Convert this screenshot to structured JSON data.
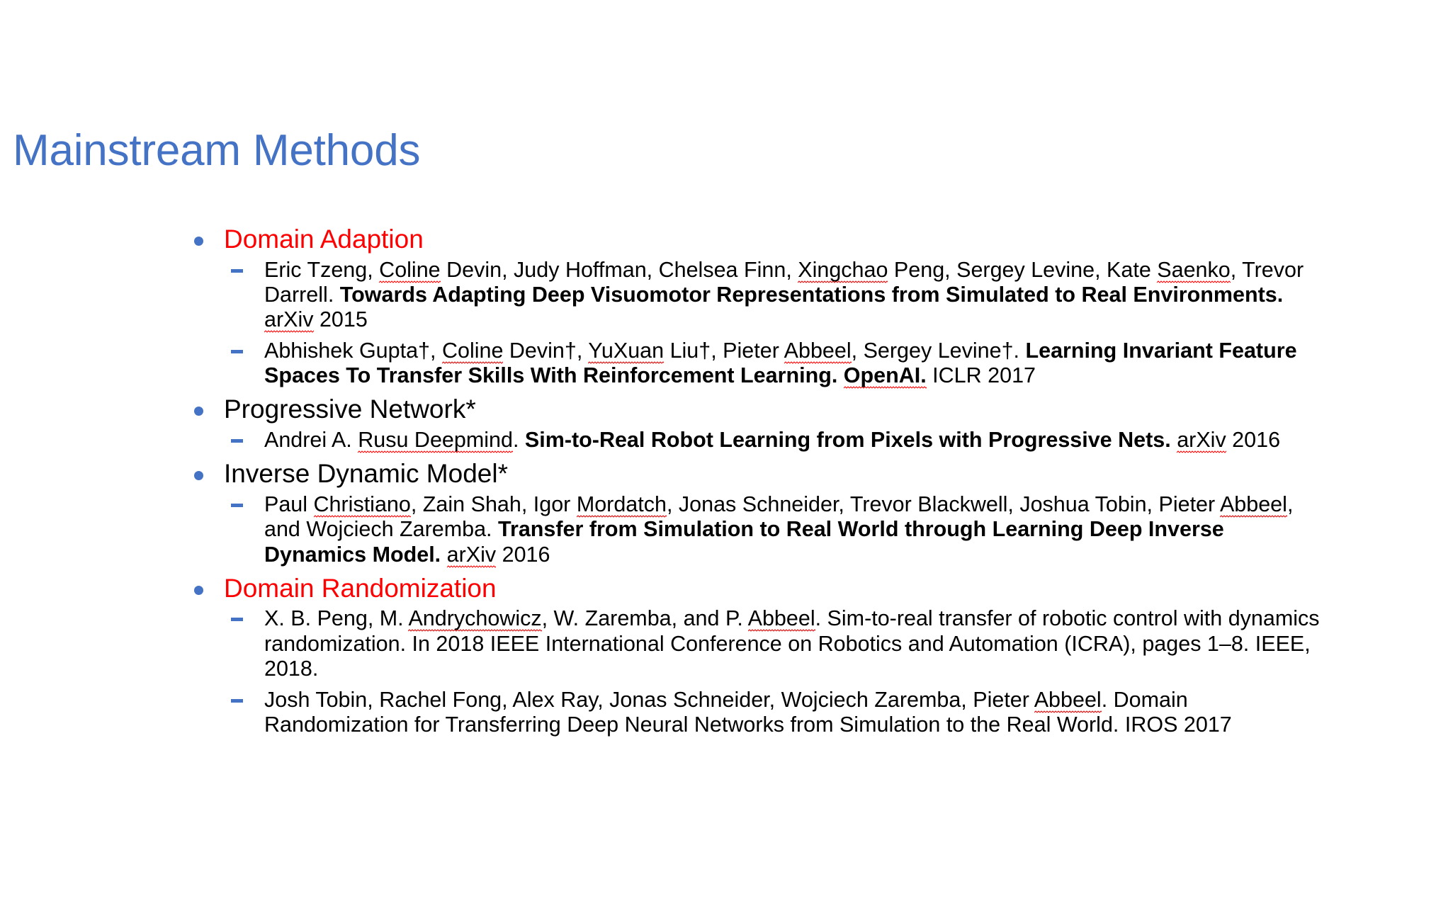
{
  "slide": {
    "title": "Mainstream Methods",
    "title_color": "#4472C4",
    "accent_red": "#FF0000",
    "bullet_color": "#4472C4",
    "background": "#FFFFFF"
  },
  "sections": [
    {
      "heading": "Domain Adaption",
      "heading_color": "#FF0000",
      "citations": [
        {
          "authors": "Eric Tzeng, Coline Devin, Judy Hoffman, Chelsea Finn, Xingchao Peng, Sergey Levine, Kate Saenko, Trevor Darrell.",
          "title": "Towards Adapting Deep Visuomotor Representations from Simulated to Real Environments.",
          "venue": "arXiv 2015",
          "misspelled": [
            "Coline",
            "Xingchao",
            "Saenko",
            "arXiv"
          ]
        },
        {
          "authors": "Abhishek Gupta†, Coline Devin†, YuXuan Liu†, Pieter Abbeel, Sergey Levine†.",
          "title": "Learning Invariant Feature Spaces To Transfer Skills With Reinforcement Learning. OpenAI.",
          "venue": "ICLR 2017",
          "misspelled": [
            "Coline",
            "YuXuan",
            "Abbeel",
            "OpenAI"
          ]
        }
      ]
    },
    {
      "heading": "Progressive Network*",
      "heading_color": "#000000",
      "citations": [
        {
          "authors": "Andrei A. Rusu Deepmind.",
          "title": "Sim-to-Real Robot Learning from Pixels with Progressive Nets.",
          "venue": "arXiv 2016",
          "misspelled": [
            "Rusu Deepmind",
            "arXiv"
          ]
        }
      ]
    },
    {
      "heading": "Inverse Dynamic Model*",
      "heading_color": "#000000",
      "citations": [
        {
          "authors": "Paul Christiano, Zain Shah, Igor Mordatch, Jonas Schneider, Trevor Blackwell, Joshua Tobin, Pieter Abbeel, and Wojciech Zaremba.",
          "title": "Transfer from Simulation to Real World through Learning Deep Inverse Dynamics Model.",
          "venue": "arXiv 2016",
          "misspelled": [
            "Christiano",
            "Mordatch",
            "Abbeel",
            "arXiv"
          ]
        }
      ]
    },
    {
      "heading": "Domain Randomization",
      "heading_color": "#FF0000",
      "citations": [
        {
          "authors": "X. B. Peng, M. Andrychowicz, W. Zaremba, and P. Abbeel.",
          "title": "",
          "venue": "Sim-to-real transfer of robotic control with dynamics randomization. In 2018 IEEE International Conference on Robotics and Automation (ICRA), pages 1–8. IEEE, 2018.",
          "misspelled": [
            "Andrychowicz",
            "Abbeel"
          ]
        },
        {
          "authors": "Josh Tobin, Rachel Fong, Alex Ray, Jonas Schneider, Wojciech Zaremba, Pieter Abbeel.",
          "title": "",
          "venue": "Domain Randomization for Transferring Deep Neural Networks from Simulation to the Real World. IROS 2017",
          "misspelled": [
            "Abbeel"
          ]
        }
      ]
    }
  ],
  "text": {
    "da_c1_p1": "Eric Tzeng, ",
    "da_c1_sq1": "Coline",
    "da_c1_p2": " Devin, Judy Hoffman, Chelsea Finn, ",
    "da_c1_sq2": "Xingchao",
    "da_c1_p3": " Peng, Sergey Levine, Kate ",
    "da_c1_sq3": "Saenko",
    "da_c1_p4": ", Trevor Darrell. ",
    "da_c1_bold": "Towards Adapting Deep Visuomotor Representations from Simulated to Real Environments.",
    "da_c1_p5": " ",
    "da_c1_sq4": "arXiv",
    "da_c1_p6": " 2015",
    "da_c2_p1": "Abhishek Gupta†, ",
    "da_c2_sq1": "Coline",
    "da_c2_p2": " Devin†, ",
    "da_c2_sq2": "YuXuan",
    "da_c2_p3": " Liu†, Pieter ",
    "da_c2_sq3": "Abbeel",
    "da_c2_p4": ", Sergey Levine†. ",
    "da_c2_bold1": "Learning Invariant Feature Spaces To Transfer Skills With Reinforcement Learning. ",
    "da_c2_boldsq": "OpenAI.",
    "da_c2_p5": " ICLR 2017",
    "pn_c1_p1": "Andrei A. ",
    "pn_c1_sq1": "Rusu Deepmind",
    "pn_c1_p2": ". ",
    "pn_c1_bold": "Sim-to-Real Robot Learning from Pixels with Progressive Nets.",
    "pn_c1_p3": " ",
    "pn_c1_sq2": "arXiv",
    "pn_c1_p4": " 2016",
    "idm_c1_p1": "Paul ",
    "idm_c1_sq1": "Christiano",
    "idm_c1_p2": ", Zain Shah, Igor ",
    "idm_c1_sq2": "Mordatch",
    "idm_c1_p3": ", Jonas Schneider, Trevor Blackwell, Joshua Tobin, Pieter ",
    "idm_c1_sq3": "Abbeel",
    "idm_c1_p4": ", and Wojciech Zaremba. ",
    "idm_c1_bold": "Transfer from Simulation to Real World through Learning Deep Inverse Dynamics Model.",
    "idm_c1_p5": " ",
    "idm_c1_sq4": "arXiv",
    "idm_c1_p6": " 2016",
    "dr_c1_p1": "X. B. Peng, M. ",
    "dr_c1_sq1": "Andrychowicz",
    "dr_c1_p2": ", W. Zaremba, and P. ",
    "dr_c1_sq2": "Abbeel",
    "dr_c1_p3": ". Sim-to-real transfer of robotic control with dynamics randomization. In 2018 IEEE International Conference on Robotics and Automation (ICRA), pages 1–8. IEEE, 2018.",
    "dr_c2_p1": "Josh Tobin, Rachel Fong, Alex Ray, Jonas Schneider, Wojciech Zaremba, Pieter ",
    "dr_c2_sq1": "Abbeel",
    "dr_c2_p2": ". Domain Randomization for Transferring Deep Neural Networks from Simulation to the Real World. IROS 2017"
  }
}
